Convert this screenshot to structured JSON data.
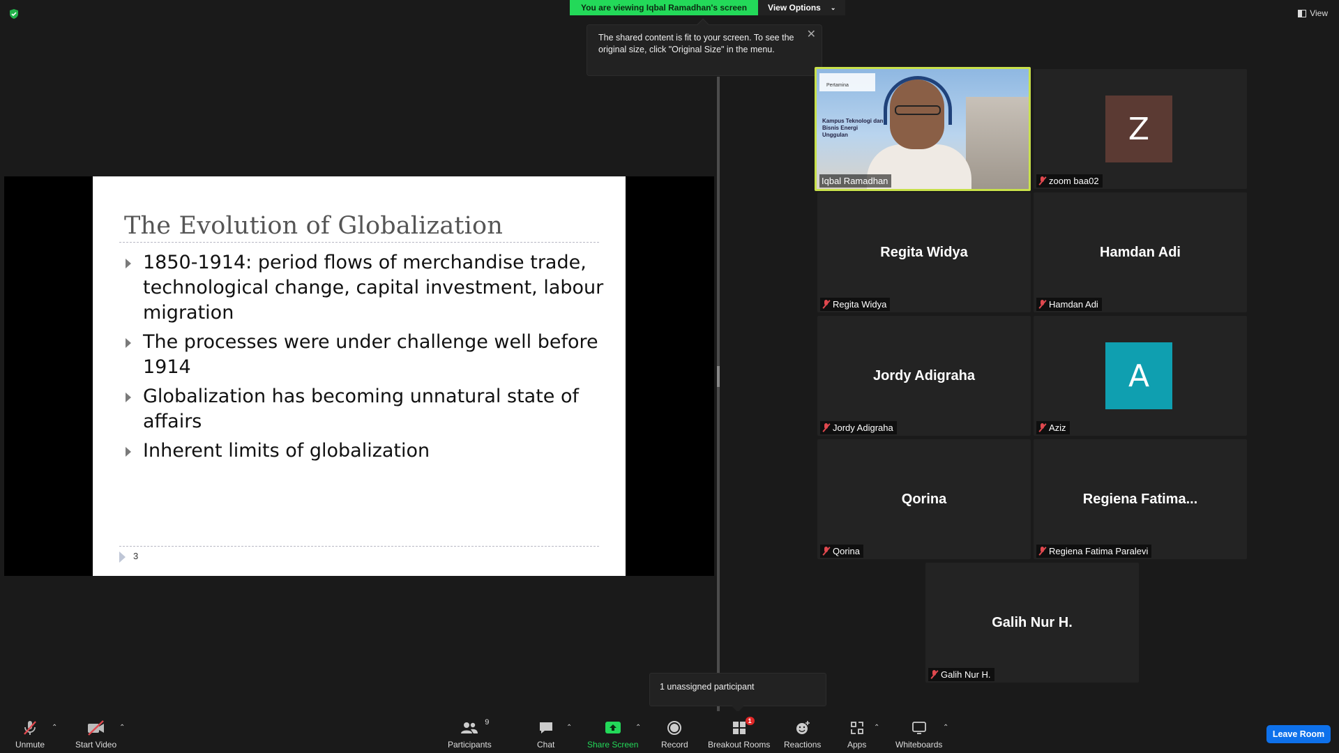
{
  "top": {
    "sharing_banner": "You are viewing Iqbal Ramadhan's screen",
    "view_options_label": "View Options",
    "view_label": "View"
  },
  "tooltip": {
    "text": "The shared content is fit to your screen. To see the original size, click \"Original Size\" in the menu."
  },
  "slide": {
    "title": "The Evolution of Globalization",
    "bullets": [
      "1850-1914: period flows of merchandise trade, technological change, capital investment, labour migration",
      "The processes were under challenge well before 1914",
      "Globalization has becoming unnatural state of affairs",
      "Inherent limits of globalization"
    ],
    "page_number": "3"
  },
  "gallery": {
    "active_speaker": {
      "name": "Iqbal Ramadhan",
      "banner_logo": "Pertamina",
      "banner_text": "Kampus Teknologi dan Bisnis Energi Unggulan"
    },
    "tiles": [
      {
        "display": "Z",
        "label": "zoom baa02",
        "avatar_color": "#5b3a33"
      },
      {
        "display": "Regita Widya",
        "label": "Regita Widya"
      },
      {
        "display": "Hamdan Adi",
        "label": "Hamdan Adi"
      },
      {
        "display": "Jordy Adigraha",
        "label": "Jordy Adigraha"
      },
      {
        "display": "A",
        "label": "Aziz",
        "avatar_color": "#0f9fb0"
      },
      {
        "display": "Qorina",
        "label": "Qorina"
      },
      {
        "display": "Regiena  Fatima...",
        "label": "Regiena Fatima Paralevi"
      },
      {
        "display": "Galih Nur H.",
        "label": "Galih Nur H."
      }
    ]
  },
  "unassigned_popup": "1 unassigned participant",
  "toolbar": {
    "unmute": "Unmute",
    "start_video": "Start Video",
    "participants": "Participants",
    "participants_count": "9",
    "chat": "Chat",
    "share_screen": "Share Screen",
    "record": "Record",
    "breakout_rooms": "Breakout Rooms",
    "breakout_badge": "1",
    "reactions": "Reactions",
    "apps": "Apps",
    "whiteboards": "Whiteboards",
    "leave_room": "Leave Room"
  },
  "colors": {
    "share_green": "#23d959",
    "active_border": "#c8e04a",
    "leave_blue": "#0e71eb",
    "muted_red": "#e0484e"
  }
}
